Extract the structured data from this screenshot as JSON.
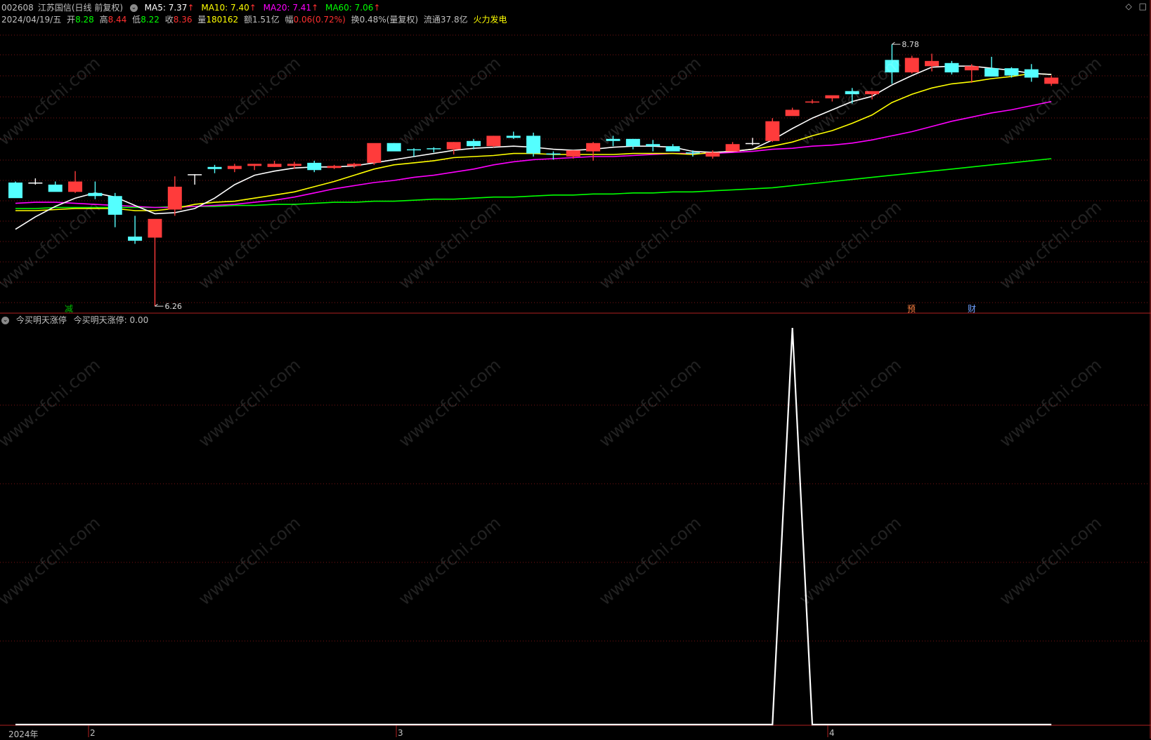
{
  "header": {
    "code": "002608",
    "name": "江苏国信",
    "mode": "(日线 前复权)",
    "ma": [
      {
        "label": "MA5: 7.37",
        "color": "#ffffff"
      },
      {
        "label": "MA10: 7.40",
        "color": "#ffff00"
      },
      {
        "label": "MA20: 7.41",
        "color": "#ff00ff"
      },
      {
        "label": "MA60: 7.06",
        "color": "#00ff00"
      }
    ],
    "arrow": "↑",
    "date": "2024/04/19/五",
    "open_label": "开",
    "open": "8.28",
    "high_label": "高",
    "high": "8.44",
    "low_label": "低",
    "low": "8.22",
    "close_label": "收",
    "close": "8.36",
    "vol_label": "量",
    "vol": "180162",
    "amt_label": "额",
    "amt": "1.51亿",
    "chg_label": "幅",
    "chg": "0.06(0.72%)",
    "turn": "换0.48%(量复权)",
    "float": "流通37.8亿",
    "concept": "火力发电"
  },
  "sub_header": {
    "name": "今买明天涨停",
    "value_text": "今买明天涨停: 0.00"
  },
  "markers": {
    "jian": "减",
    "yu": "预",
    "cai": "财"
  },
  "x_axis": {
    "labels": [
      "2024年",
      "2",
      "3",
      "4"
    ]
  },
  "icons": [
    "diamond-icon",
    "square-icon"
  ],
  "chart_data": [
    {
      "type": "candlestick",
      "title": "",
      "candles": [
        {
          "o": 7.45,
          "h": 7.46,
          "l": 7.32,
          "c": 7.3
        },
        {
          "o": 7.45,
          "h": 7.49,
          "l": 7.43,
          "c": 7.45
        },
        {
          "o": 7.43,
          "h": 7.46,
          "l": 7.38,
          "c": 7.36
        },
        {
          "o": 7.36,
          "h": 7.56,
          "l": 7.35,
          "c": 7.46
        },
        {
          "o": 7.35,
          "h": 7.46,
          "l": 7.29,
          "c": 7.32
        },
        {
          "o": 7.32,
          "h": 7.35,
          "l": 7.02,
          "c": 7.14
        },
        {
          "o": 6.93,
          "h": 7.13,
          "l": 6.86,
          "c": 6.89
        },
        {
          "o": 6.92,
          "h": 7.07,
          "l": 6.26,
          "c": 7.1
        },
        {
          "o": 7.19,
          "h": 7.51,
          "l": 7.13,
          "c": 7.41
        },
        {
          "o": 7.53,
          "h": 7.53,
          "l": 7.43,
          "c": 7.53
        },
        {
          "o": 7.6,
          "h": 7.62,
          "l": 7.54,
          "c": 7.58
        },
        {
          "o": 7.58,
          "h": 7.63,
          "l": 7.55,
          "c": 7.61
        },
        {
          "o": 7.61,
          "h": 7.63,
          "l": 7.57,
          "c": 7.63
        },
        {
          "o": 7.6,
          "h": 7.66,
          "l": 7.6,
          "c": 7.63
        },
        {
          "o": 7.61,
          "h": 7.65,
          "l": 7.58,
          "c": 7.63
        },
        {
          "o": 7.64,
          "h": 7.66,
          "l": 7.55,
          "c": 7.57
        },
        {
          "o": 7.59,
          "h": 7.62,
          "l": 7.58,
          "c": 7.61
        },
        {
          "o": 7.61,
          "h": 7.64,
          "l": 7.59,
          "c": 7.63
        },
        {
          "o": 7.64,
          "h": 7.79,
          "l": 7.62,
          "c": 7.83
        },
        {
          "o": 7.83,
          "h": 7.83,
          "l": 7.79,
          "c": 7.75
        },
        {
          "o": 7.77,
          "h": 7.78,
          "l": 7.7,
          "c": 7.76
        },
        {
          "o": 7.78,
          "h": 7.79,
          "l": 7.74,
          "c": 7.77
        },
        {
          "o": 7.77,
          "h": 7.84,
          "l": 7.72,
          "c": 7.84
        },
        {
          "o": 7.85,
          "h": 7.87,
          "l": 7.77,
          "c": 7.8
        },
        {
          "o": 7.8,
          "h": 7.9,
          "l": 7.79,
          "c": 7.9
        },
        {
          "o": 7.9,
          "h": 7.94,
          "l": 7.87,
          "c": 7.88
        },
        {
          "o": 7.9,
          "h": 7.93,
          "l": 7.7,
          "c": 7.73
        },
        {
          "o": 7.73,
          "h": 7.75,
          "l": 7.67,
          "c": 7.72
        },
        {
          "o": 7.7,
          "h": 7.75,
          "l": 7.68,
          "c": 7.76
        },
        {
          "o": 7.75,
          "h": 7.84,
          "l": 7.66,
          "c": 7.83
        },
        {
          "o": 7.87,
          "h": 7.9,
          "l": 7.8,
          "c": 7.85
        },
        {
          "o": 7.87,
          "h": 7.87,
          "l": 7.77,
          "c": 7.8
        },
        {
          "o": 7.82,
          "h": 7.86,
          "l": 7.75,
          "c": 7.8
        },
        {
          "o": 7.8,
          "h": 7.82,
          "l": 7.76,
          "c": 7.75
        },
        {
          "o": 7.74,
          "h": 7.76,
          "l": 7.7,
          "c": 7.73
        },
        {
          "o": 7.7,
          "h": 7.76,
          "l": 7.68,
          "c": 7.74
        },
        {
          "o": 7.75,
          "h": 7.84,
          "l": 7.76,
          "c": 7.82
        },
        {
          "o": 7.83,
          "h": 7.88,
          "l": 7.81,
          "c": 7.83
        },
        {
          "o": 7.85,
          "h": 8.07,
          "l": 7.84,
          "c": 8.04
        },
        {
          "o": 8.09,
          "h": 8.17,
          "l": 8.1,
          "c": 8.15
        },
        {
          "o": 8.22,
          "h": 8.25,
          "l": 8.21,
          "c": 8.23
        },
        {
          "o": 8.26,
          "h": 8.27,
          "l": 8.23,
          "c": 8.29
        },
        {
          "o": 8.33,
          "h": 8.36,
          "l": 8.21,
          "c": 8.3
        },
        {
          "o": 8.3,
          "h": 8.33,
          "l": 8.25,
          "c": 8.33
        },
        {
          "o": 8.63,
          "h": 8.78,
          "l": 8.4,
          "c": 8.51
        },
        {
          "o": 8.51,
          "h": 8.67,
          "l": 8.5,
          "c": 8.65
        },
        {
          "o": 8.57,
          "h": 8.69,
          "l": 8.52,
          "c": 8.62
        },
        {
          "o": 8.6,
          "h": 8.62,
          "l": 8.49,
          "c": 8.51
        },
        {
          "o": 8.53,
          "h": 8.59,
          "l": 8.41,
          "c": 8.57
        },
        {
          "o": 8.55,
          "h": 8.66,
          "l": 8.47,
          "c": 8.47
        },
        {
          "o": 8.55,
          "h": 8.56,
          "l": 8.46,
          "c": 8.48
        },
        {
          "o": 8.54,
          "h": 8.59,
          "l": 8.42,
          "c": 8.46
        },
        {
          "o": 8.4,
          "h": 8.48,
          "l": 8.38,
          "c": 8.46
        }
      ],
      "ma5": [
        7.0,
        7.12,
        7.22,
        7.3,
        7.35,
        7.31,
        7.23,
        7.15,
        7.16,
        7.2,
        7.3,
        7.43,
        7.52,
        7.56,
        7.59,
        7.6,
        7.6,
        7.61,
        7.64,
        7.67,
        7.7,
        7.73,
        7.76,
        7.78,
        7.79,
        7.8,
        7.79,
        7.77,
        7.76,
        7.77,
        7.79,
        7.8,
        7.8,
        7.79,
        7.75,
        7.74,
        7.75,
        7.77,
        7.86,
        7.97,
        8.07,
        8.15,
        8.23,
        8.28,
        8.39,
        8.48,
        8.56,
        8.57,
        8.57,
        8.55,
        8.53,
        8.5,
        8.49
      ],
      "ma10": [
        7.18,
        7.18,
        7.19,
        7.2,
        7.2,
        7.2,
        7.18,
        7.18,
        7.2,
        7.24,
        7.26,
        7.27,
        7.3,
        7.33,
        7.36,
        7.41,
        7.46,
        7.52,
        7.58,
        7.62,
        7.64,
        7.66,
        7.69,
        7.7,
        7.71,
        7.73,
        7.73,
        7.72,
        7.72,
        7.72,
        7.72,
        7.73,
        7.73,
        7.73,
        7.72,
        7.74,
        7.75,
        7.77,
        7.8,
        7.84,
        7.9,
        7.95,
        8.02,
        8.1,
        8.22,
        8.3,
        8.36,
        8.4,
        8.42,
        8.45,
        8.47,
        8.5,
        8.49
      ],
      "ma20": [
        7.25,
        7.26,
        7.26,
        7.25,
        7.24,
        7.23,
        7.22,
        7.21,
        7.21,
        7.22,
        7.23,
        7.24,
        7.26,
        7.28,
        7.31,
        7.35,
        7.39,
        7.42,
        7.45,
        7.47,
        7.5,
        7.52,
        7.55,
        7.58,
        7.62,
        7.65,
        7.67,
        7.68,
        7.69,
        7.7,
        7.7,
        7.71,
        7.72,
        7.73,
        7.73,
        7.73,
        7.74,
        7.75,
        7.77,
        7.78,
        7.8,
        7.81,
        7.83,
        7.86,
        7.9,
        7.94,
        7.99,
        8.04,
        8.08,
        8.12,
        8.15,
        8.19,
        8.23
      ],
      "ma60": [
        7.2,
        7.2,
        7.21,
        7.21,
        7.21,
        7.21,
        7.21,
        7.21,
        7.22,
        7.22,
        7.22,
        7.23,
        7.23,
        7.24,
        7.24,
        7.25,
        7.26,
        7.26,
        7.27,
        7.27,
        7.28,
        7.29,
        7.29,
        7.3,
        7.31,
        7.31,
        7.32,
        7.33,
        7.33,
        7.34,
        7.34,
        7.35,
        7.35,
        7.36,
        7.36,
        7.37,
        7.38,
        7.39,
        7.4,
        7.42,
        7.44,
        7.46,
        7.48,
        7.5,
        7.52,
        7.54,
        7.56,
        7.58,
        7.6,
        7.62,
        7.64,
        7.66,
        7.68
      ],
      "annotations": [
        {
          "label": "8.78",
          "value": 8.78,
          "index": 44
        },
        {
          "label": "6.26",
          "value": 6.26,
          "index": 7
        }
      ],
      "ylim": [
        6.2,
        8.95
      ],
      "colors": {
        "up": "#ff3b3b",
        "down": "#54ffff",
        "doji": "#ffffff"
      }
    },
    {
      "type": "line",
      "title": "今买明天涨停",
      "series": [
        {
          "name": "今买明天涨停",
          "color": "#ffffff",
          "values": [
            0,
            0,
            0,
            0,
            0,
            0,
            0,
            0,
            0,
            0,
            0,
            0,
            0,
            0,
            0,
            0,
            0,
            0,
            0,
            0,
            0,
            0,
            0,
            0,
            0,
            0,
            0,
            0,
            0,
            0,
            0,
            0,
            0,
            0,
            0,
            0,
            0,
            0,
            0,
            1,
            0,
            0,
            0,
            0,
            0,
            0,
            0,
            0,
            0,
            0,
            0,
            0,
            0
          ]
        }
      ],
      "ylim": [
        0,
        1
      ]
    }
  ]
}
